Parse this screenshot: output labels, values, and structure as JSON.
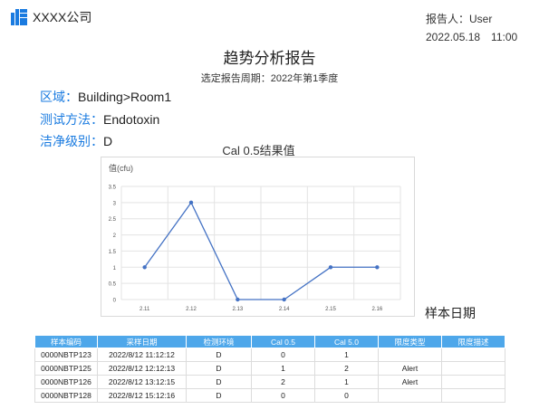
{
  "header": {
    "logo_icon": "bar-grid-icon",
    "brand_color": "#1a7be0",
    "company": "XXXX公司",
    "reporter": "报告人：User",
    "datetime": "2022.05.18　11:00"
  },
  "report": {
    "title": "趋势分析报告",
    "period": "选定报告周期：2022年第1季度"
  },
  "meta": {
    "area_label": "区域：",
    "area_value": "Building>Room1",
    "method_label": "测试方法：",
    "method_value": "Endotoxin",
    "grade_label": "洁净级别：",
    "grade_value": "D"
  },
  "chart_data": {
    "type": "line",
    "title": "Cal 0.5结果值",
    "ylabel": "值(cfu)",
    "xlabel": "样本日期",
    "categories": [
      "2.11",
      "2.12",
      "2.13",
      "2.14",
      "2.15",
      "2.16"
    ],
    "values": [
      1,
      3,
      0,
      0,
      1,
      1
    ],
    "ylim": [
      0,
      3.5
    ],
    "yticks": [
      "0",
      "0.5",
      "1",
      "1.5",
      "2",
      "2.5",
      "3",
      "3.5"
    ],
    "grid": true,
    "line_color": "#4472c4"
  },
  "table": {
    "header_color": "#4ea7ea",
    "headers": [
      "样本编码",
      "采样日期",
      "检测环境",
      "Cal 0.5",
      "Cal 5.0",
      "限度类型",
      "限度描述"
    ],
    "rows": [
      [
        "0000NBTP123",
        "2022/8/12 11:12:12",
        "D",
        "0",
        "1",
        "",
        ""
      ],
      [
        "0000NBTP125",
        "2022/8/12 12:12:13",
        "D",
        "1",
        "2",
        "Alert",
        ""
      ],
      [
        "0000NBTP126",
        "2022/8/12 13:12:15",
        "D",
        "2",
        "1",
        "Alert",
        ""
      ],
      [
        "0000NBTP128",
        "2022/8/12 15:12:16",
        "D",
        "0",
        "0",
        "",
        ""
      ]
    ]
  }
}
